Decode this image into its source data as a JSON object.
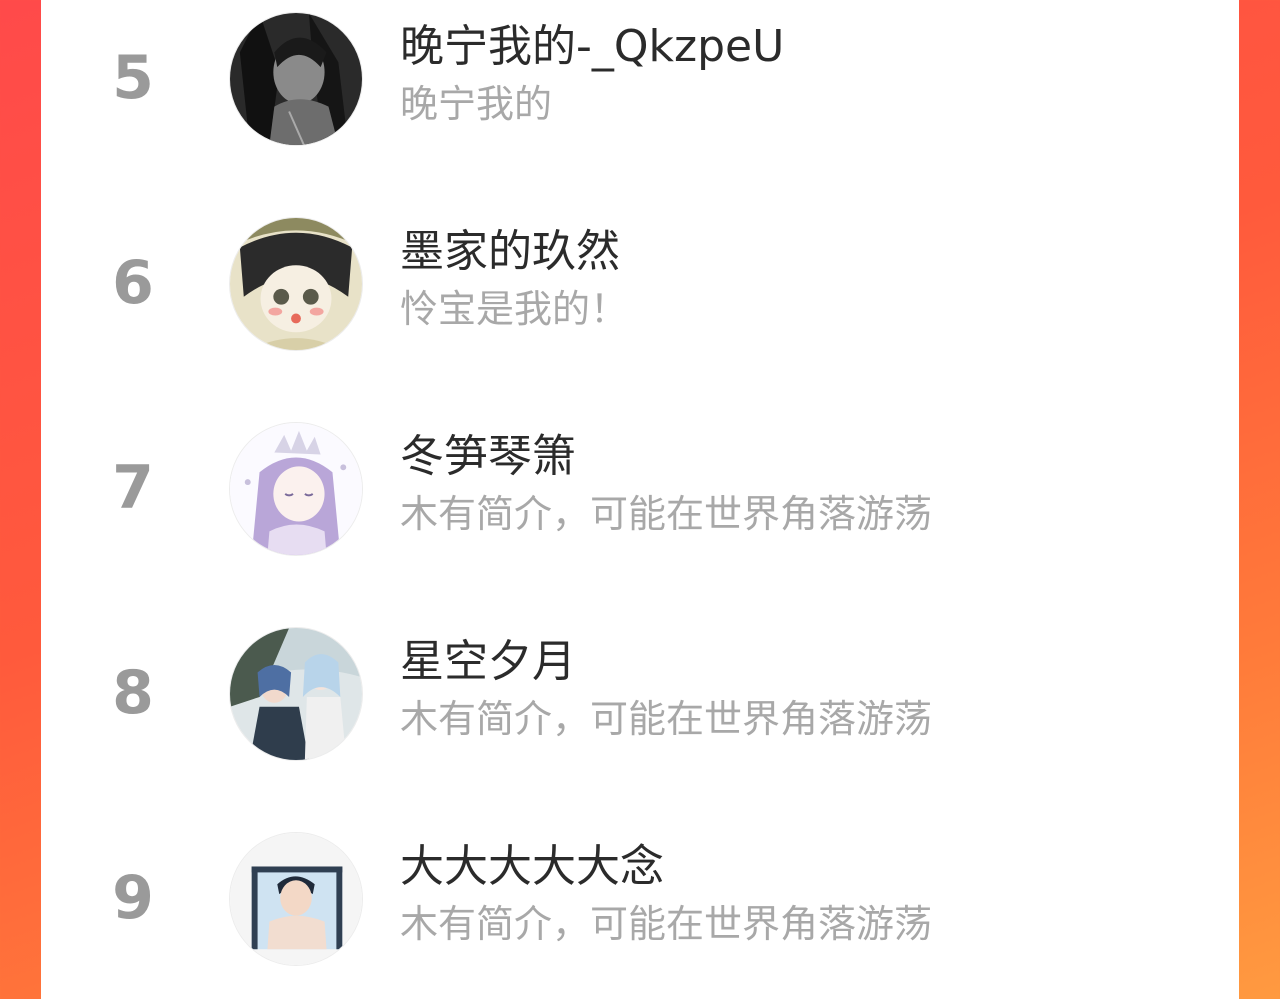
{
  "ranking": {
    "items": [
      {
        "rank": "5",
        "name": "晚宁我的-_QkzpeU",
        "bio": "晚宁我的",
        "avatar_icon": "avatar-dark-anime-portrait"
      },
      {
        "rank": "6",
        "name": "墨家的玖然",
        "bio": "怜宝是我的！",
        "avatar_icon": "avatar-chibi-anime-portrait"
      },
      {
        "rank": "7",
        "name": "冬笋琴箫",
        "bio": "木有简介，可能在世界角落游荡",
        "avatar_icon": "avatar-lavender-hair-portrait"
      },
      {
        "rank": "8",
        "name": "星空夕月",
        "bio": "木有简介，可能在世界角落游荡",
        "avatar_icon": "avatar-two-characters-illustration"
      },
      {
        "rank": "9",
        "name": "大大大大大念",
        "bio": "木有简介，可能在世界角落游荡",
        "avatar_icon": "avatar-boy-in-doorway"
      }
    ]
  },
  "colors": {
    "background_gradient_start": "#ff4a4a",
    "background_gradient_end": "#ff9a40",
    "rank_color": "#9a9a9a",
    "name_color": "#2b2b2b",
    "bio_color": "#a8a8a8"
  }
}
